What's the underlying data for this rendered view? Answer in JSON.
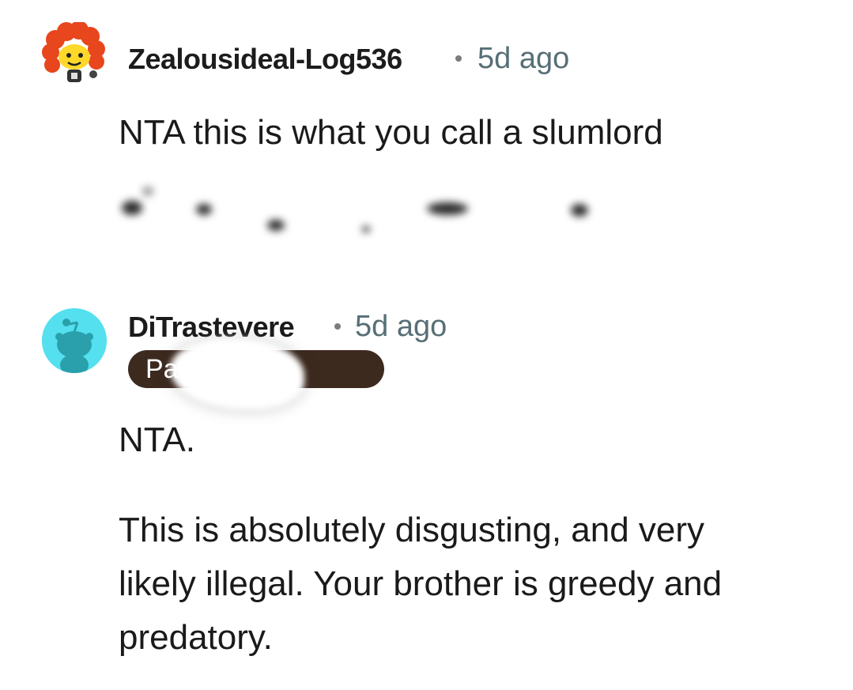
{
  "comments": [
    {
      "author": "Zealousideal-Log536",
      "separator": "•",
      "time": "5d ago",
      "body": "NTA this is what you call a slumlord",
      "avatar_icon": "curly-orange-hair-avatar-icon"
    },
    {
      "author": "DiTrastevere",
      "separator": "•",
      "time": "5d ago",
      "flair": "Pa            nt [1]",
      "body_lines": [
        "NTA."
      ],
      "body_paragraph": [
        "This is absolutely disgusting, and very",
        "likely illegal. Your brother is greedy and",
        "predatory."
      ],
      "avatar_icon": "snoo-default-avatar-icon",
      "avatar_bg": "#54e0ee"
    }
  ]
}
